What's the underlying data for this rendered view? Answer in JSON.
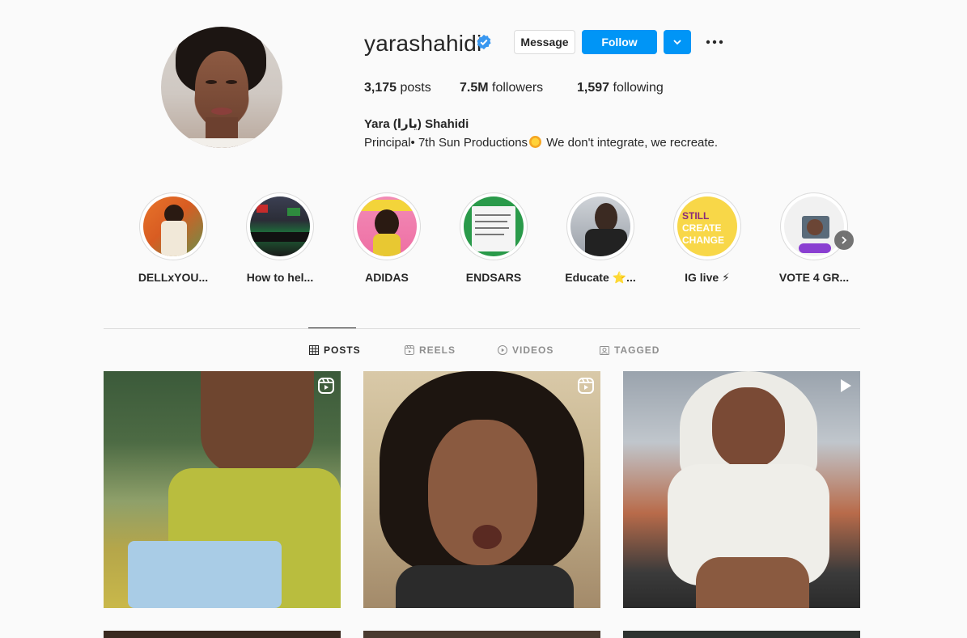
{
  "profile": {
    "username": "yarashahidi",
    "verified": true,
    "buttons": {
      "message": "Message",
      "follow": "Follow"
    },
    "stats": {
      "posts_count": "3,175",
      "posts_label": "posts",
      "followers_count": "7.5M",
      "followers_label": "followers",
      "following_count": "1,597",
      "following_label": "following"
    },
    "full_name": "Yara (يارا) Shahidi",
    "bio_part1": "Principal• 7th Sun Productions",
    "bio_part2": " We don't integrate, we recreate."
  },
  "highlights": [
    {
      "label": "DELLxYOU..."
    },
    {
      "label": "How to hel..."
    },
    {
      "label": "ADIDAS"
    },
    {
      "label": "ENDSARS"
    },
    {
      "label": "Educate ⭐..."
    },
    {
      "label": "IG live ⚡"
    },
    {
      "label": "VOTE 4 GR..."
    }
  ],
  "highlight_text": {
    "still": "STILL",
    "create": "CREATE",
    "change": "CHANGE"
  },
  "tabs": [
    {
      "label": "POSTS",
      "active": true
    },
    {
      "label": "REELS",
      "active": false
    },
    {
      "label": "VIDEOS",
      "active": false
    },
    {
      "label": "TAGGED",
      "active": false
    }
  ],
  "posts": [
    {
      "type": "reel"
    },
    {
      "type": "reel"
    },
    {
      "type": "video"
    }
  ],
  "colors": {
    "accent": "#0095f6",
    "verified": "#3897f0",
    "background": "#fafafa"
  }
}
